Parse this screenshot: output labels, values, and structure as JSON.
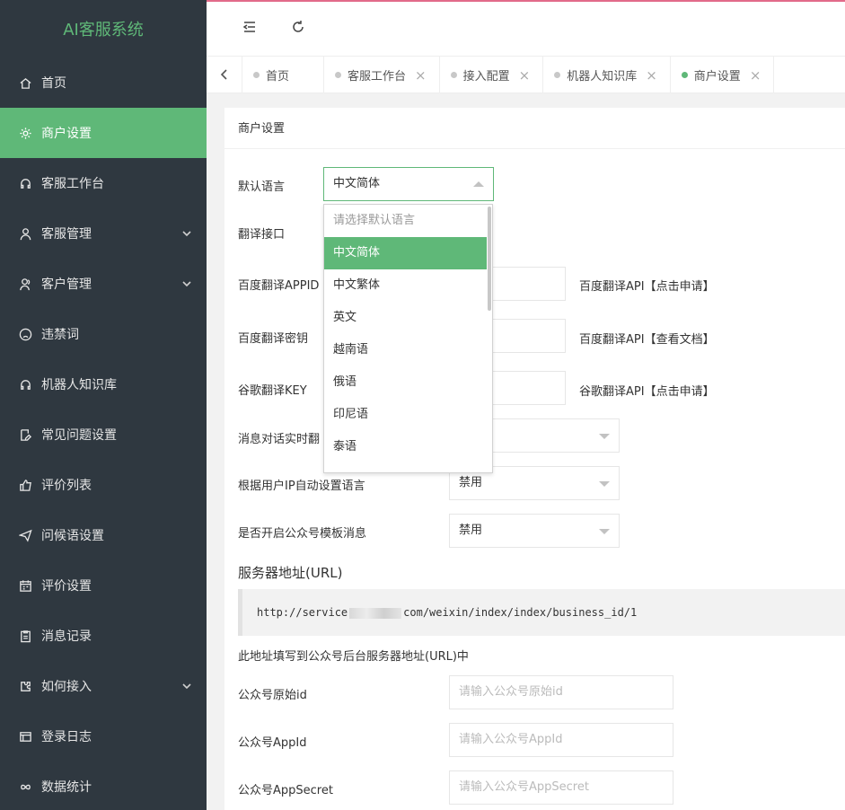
{
  "brand": "AI客服系统",
  "colors": {
    "accent": "#5fb878",
    "sidebar_bg": "#2f3840",
    "top_border": "#e26a8a"
  },
  "sidebar": {
    "items": [
      {
        "label": "首页",
        "icon": "home-icon"
      },
      {
        "label": "商户设置",
        "icon": "gear-icon",
        "active": true
      },
      {
        "label": "客服工作台",
        "icon": "headset-icon"
      },
      {
        "label": "客服管理",
        "icon": "user-icon",
        "expandable": true
      },
      {
        "label": "客户管理",
        "icon": "users-icon",
        "expandable": true
      },
      {
        "label": "违禁词",
        "icon": "frown-icon"
      },
      {
        "label": "机器人知识库",
        "icon": "headset-icon"
      },
      {
        "label": "常见问题设置",
        "icon": "edit-icon"
      },
      {
        "label": "评价列表",
        "icon": "thumb-up-icon"
      },
      {
        "label": "问候语设置",
        "icon": "send-icon"
      },
      {
        "label": "评价设置",
        "icon": "calendar-icon"
      },
      {
        "label": "消息记录",
        "icon": "clipboard-icon"
      },
      {
        "label": "如何接入",
        "icon": "puzzle-icon",
        "expandable": true
      },
      {
        "label": "登录日志",
        "icon": "log-icon"
      },
      {
        "label": "数据统计",
        "icon": "infinity-icon"
      }
    ]
  },
  "tabs": [
    {
      "label": "首页",
      "closable": false
    },
    {
      "label": "客服工作台",
      "closable": true
    },
    {
      "label": "接入配置",
      "closable": true
    },
    {
      "label": "机器人知识库",
      "closable": true
    },
    {
      "label": "商户设置",
      "closable": true,
      "active": true
    }
  ],
  "tab_close_glyph": "×",
  "card": {
    "title": "商户设置"
  },
  "form": {
    "default_language": {
      "label": "默认语言",
      "value": "中文简体"
    },
    "translate_api": {
      "label": "翻译接口"
    },
    "baidu_appid": {
      "label": "百度翻译APPID",
      "help": "百度翻译API【点击申请】"
    },
    "baidu_secret": {
      "label": "百度翻译密钥",
      "help": "百度翻译API【查看文档】"
    },
    "google_key": {
      "label": "谷歌翻译KEY",
      "help": "谷歌翻译API【点击申请】"
    },
    "realtime_translate": {
      "label": "消息对话实时翻"
    },
    "ip_language": {
      "label": "根据用户IP自动设置语言",
      "value": "禁用"
    },
    "mp_template": {
      "label": "是否开启公众号模板消息",
      "value": "禁用"
    },
    "server_url": {
      "title": "服务器地址(URL)",
      "prefix": "http://service",
      "suffix": "com/weixin/index/index/business_id/1",
      "note": "此地址填写到公众号后台服务器地址(URL)中"
    },
    "mp_original_id": {
      "label": "公众号原始id",
      "placeholder": "请输入公众号原始id"
    },
    "mp_appid": {
      "label": "公众号AppId",
      "placeholder": "请输入公众号AppId"
    },
    "mp_appsecret": {
      "label": "公众号AppSecret",
      "placeholder": "请输入公众号AppSecret"
    }
  },
  "language_dropdown": {
    "placeholder": "请选择默认语言",
    "options": [
      "中文简体",
      "中文繁体",
      "英文",
      "越南语",
      "俄语",
      "印尼语",
      "泰语"
    ],
    "selected": "中文简体"
  }
}
